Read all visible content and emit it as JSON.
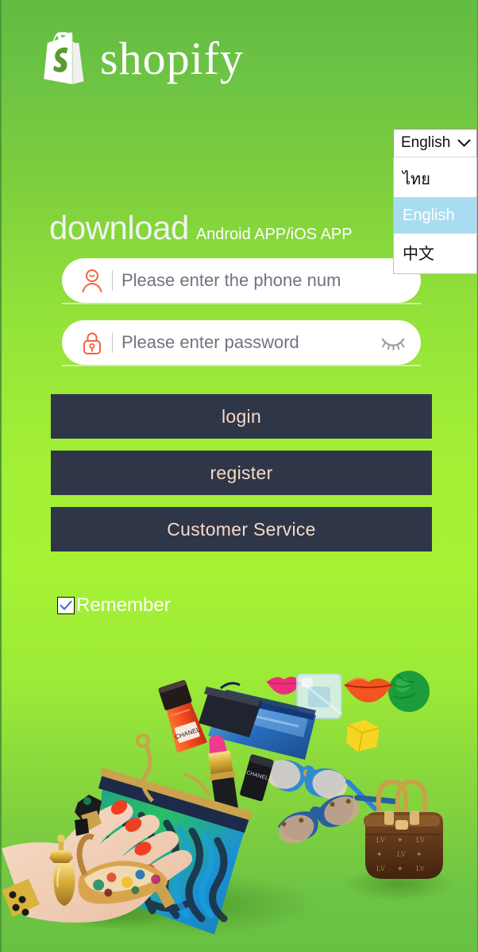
{
  "app": {
    "brand_name": "shopify",
    "background_top_color": "#63bb42",
    "background_mid_color": "#a6f235",
    "background_bottom_color": "#69c142"
  },
  "language_select": {
    "selected": "English",
    "chevron": "⌄",
    "options": [
      {
        "label": "ไทย",
        "selected": false
      },
      {
        "label": "English",
        "selected": true
      },
      {
        "label": "中文",
        "selected": false
      }
    ],
    "highlight_color": "#a9dcf0"
  },
  "heading": {
    "primary": "download",
    "secondary": "Android APP/iOS APP"
  },
  "form": {
    "phone": {
      "placeholder": "Please enter the phone num",
      "value": "",
      "icon": "user-icon",
      "icon_color": "#f4623a"
    },
    "password": {
      "placeholder": "Please enter password",
      "value": "",
      "icon": "lock-icon",
      "icon_color": "#f4623a",
      "toggle_icon": "eye-off-icon",
      "toggle_icon_color": "#9aa0a6"
    }
  },
  "buttons": {
    "login": "login",
    "register": "register",
    "customer_service": "Customer Service",
    "background_color": "#2e3648",
    "text_color": "#f7d9c6"
  },
  "remember": {
    "label": "Remember",
    "checked": true,
    "check_color": "#4a76c4"
  },
  "collage": {
    "alt": "fashion products collage with hand, clutch bag, lipstick, sunglasses, perfume, high heel and handbag"
  }
}
